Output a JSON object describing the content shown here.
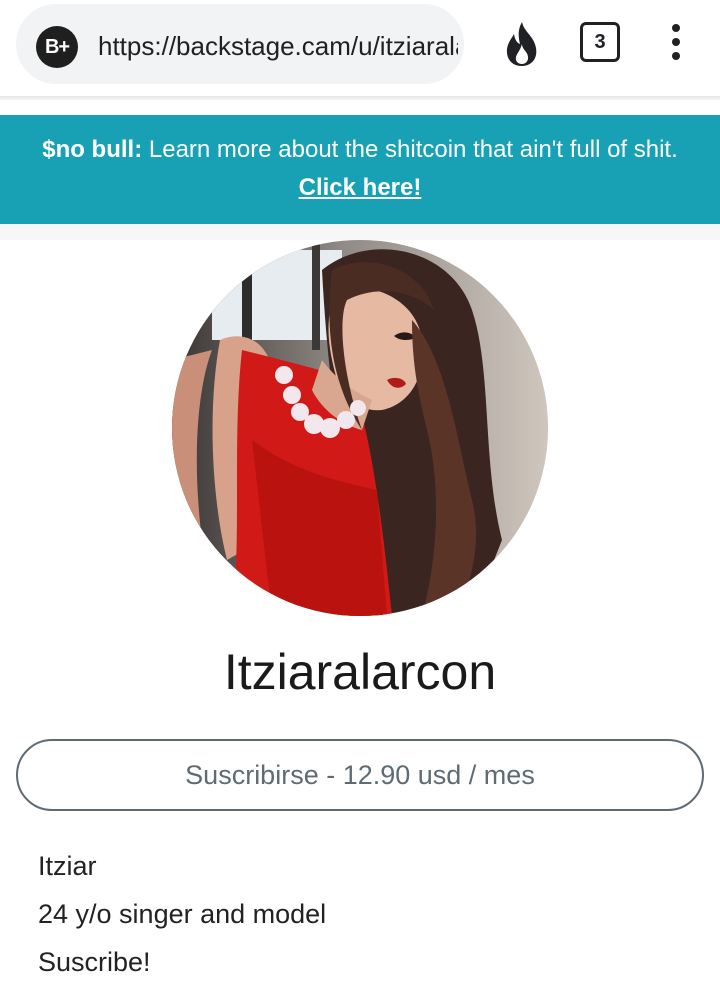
{
  "browser": {
    "site_badge": "B+",
    "url": "https://backstage.cam/u/itziaralarcon",
    "tab_count": "3",
    "icons": [
      "fire-icon",
      "tabs-icon",
      "more-vert-icon"
    ]
  },
  "banner": {
    "bold_text": "$no bull:",
    "text": " Learn more about the shitcoin that ain't full of shit.",
    "link": "Click here!",
    "background": "#18a0b4"
  },
  "profile": {
    "username": "Itziaralarcon",
    "subscribe_label": "Suscribirse - 12.90 usd / mes",
    "bio": [
      "Itziar",
      "24 y/o singer and model",
      "Suscribe!"
    ]
  }
}
